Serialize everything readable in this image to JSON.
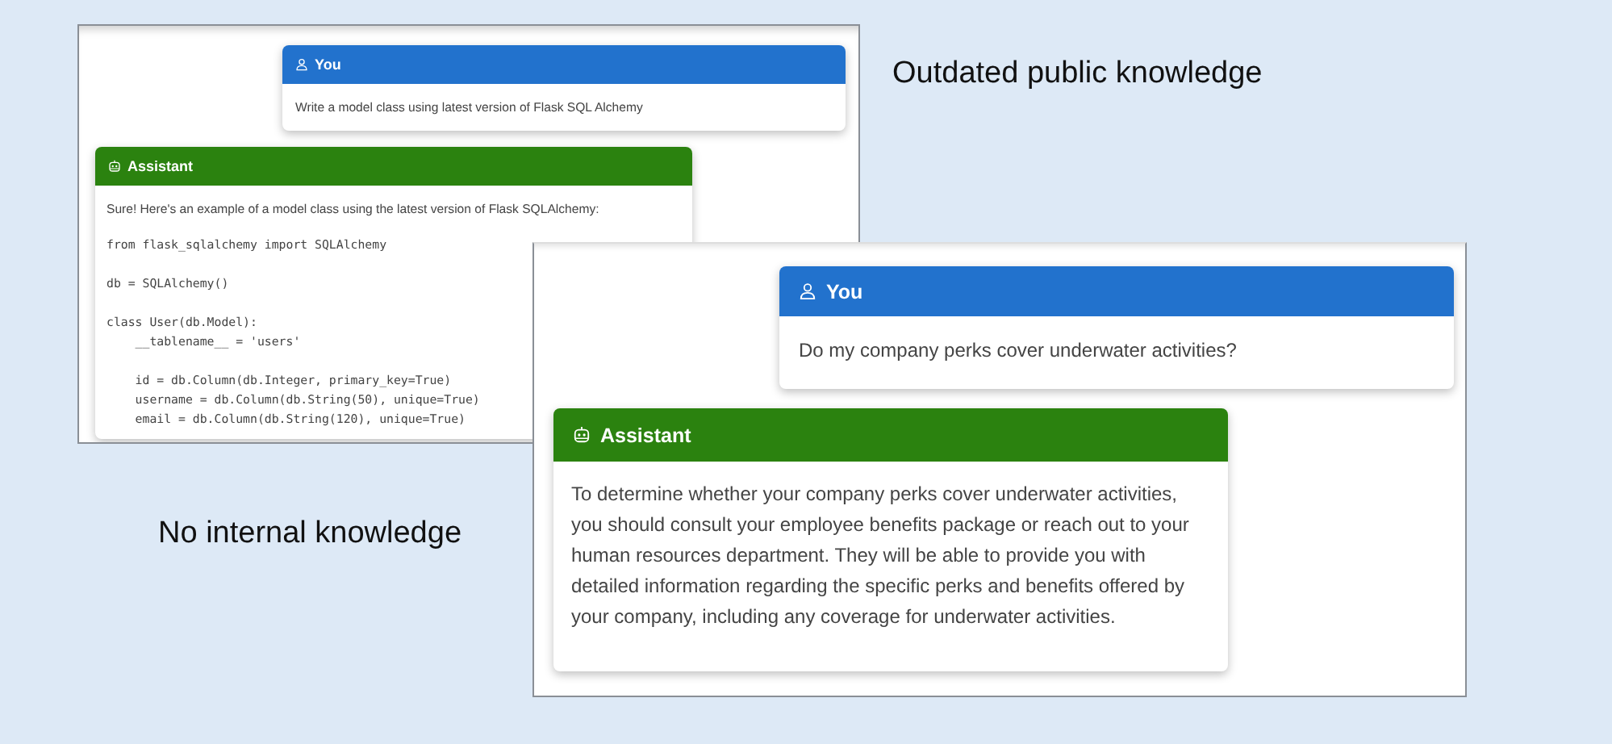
{
  "screenshots": [
    {
      "messages": [
        {
          "kind": "user",
          "title": "You",
          "text": "Write a model class using latest version of Flask SQL Alchemy"
        },
        {
          "kind": "assistant",
          "title": "Assistant",
          "text": "Sure! Here's an example of a model class using the latest version of Flask SQLAlchemy:",
          "code_blocks": [
            [
              "from flask_sqlalchemy import SQLAlchemy"
            ],
            [
              "db = SQLAlchemy()"
            ],
            [
              "class User(db.Model):",
              "    __tablename__ = 'users'"
            ],
            [
              "    id = db.Column(db.Integer, primary_key=True)",
              "    username = db.Column(db.String(50), unique=True)",
              "    email = db.Column(db.String(120), unique=True)"
            ]
          ]
        }
      ]
    },
    {
      "messages": [
        {
          "kind": "user",
          "title": "You",
          "text": "Do my company perks cover underwater activities?"
        },
        {
          "kind": "assistant",
          "title": "Assistant",
          "text": "To determine whether your company perks cover underwater activities, you should consult your employee benefits package or reach out to your human resources department. They will be able to provide you with detailed information regarding the specific perks and benefits offered by your company, including any coverage for underwater activities."
        }
      ]
    }
  ],
  "captions": [
    "Outdated public knowledge",
    "No internal knowledge"
  ]
}
